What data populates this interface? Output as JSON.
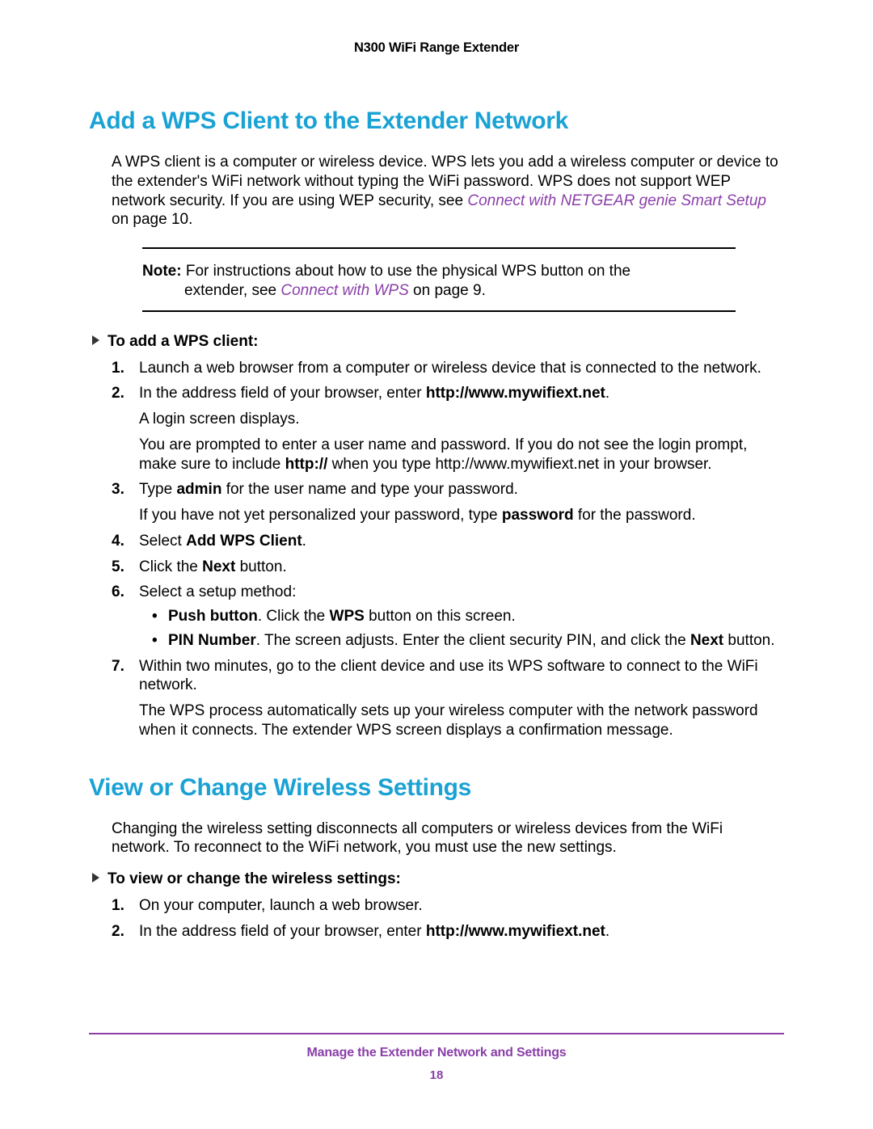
{
  "header": "N300 WiFi Range Extender",
  "section1": {
    "title": "Add a WPS Client to the Extender Network",
    "intro_a": "A WPS client is a computer or wireless device. WPS lets you add a wireless computer or device to the extender's WiFi network without typing the WiFi password. WPS does not support WEP network security. If you are using WEP security, see ",
    "intro_link": "Connect with NETGEAR genie Smart Setup",
    "intro_b": " on page 10.",
    "note_label": "Note:",
    "note_a": " For instructions about how to use the physical WPS button on the ",
    "note_b": "extender, see ",
    "note_link": "Connect with WPS",
    "note_c": " on page 9.",
    "task": "To add a WPS client:",
    "steps": {
      "s1": "Launch a web browser from a computer or wireless device that is connected to the network.",
      "s2a": "In the address field of your browser, enter ",
      "s2b": "http://www.mywifiext.net",
      "s2c": ".",
      "s2_sub1": "A login screen displays.",
      "s2_sub2": "You are prompted to enter a user name and password. If you do not see the login prompt, make sure to include ",
      "s2_sub2b": "http://",
      "s2_sub2c": " when you type http://www.mywifiext.net in your browser.",
      "s3a": "Type ",
      "s3b": "admin",
      "s3c": " for the user name and type your password.",
      "s3_sub1a": "If you have not yet personalized your password, type ",
      "s3_sub1b": "password",
      "s3_sub1c": " for the password.",
      "s4a": "Select ",
      "s4b": "Add WPS Client",
      "s4c": ".",
      "s5a": "Click the ",
      "s5b": "Next",
      "s5c": " button.",
      "s6": "Select a setup method:",
      "s6_b1a": "Push button",
      "s6_b1b": ". Click the ",
      "s6_b1c": "WPS",
      "s6_b1d": " button on this screen.",
      "s6_b2a": "PIN Number",
      "s6_b2b": ". The screen adjusts. Enter the client security PIN, and click the ",
      "s6_b2c": "Next",
      "s6_b2d": " button.",
      "s7": "Within two minutes, go to the client device and use its WPS software to connect to the WiFi network.",
      "s7_sub": "The WPS process automatically sets up your wireless computer with the network password when it connects. The extender WPS screen displays a confirmation message."
    }
  },
  "section2": {
    "title": "View or Change Wireless Settings",
    "intro": "Changing the wireless setting disconnects all computers or wireless devices from the WiFi network. To reconnect to the WiFi network, you must use the new settings.",
    "task": "To view or change the wireless settings:",
    "steps": {
      "s1": "On your computer, launch a web browser.",
      "s2a": "In the address field of your browser, enter ",
      "s2b": "http://www.mywifiext.net",
      "s2c": "."
    }
  },
  "footer": {
    "title": "Manage the Extender Network and Settings",
    "page": "18"
  }
}
